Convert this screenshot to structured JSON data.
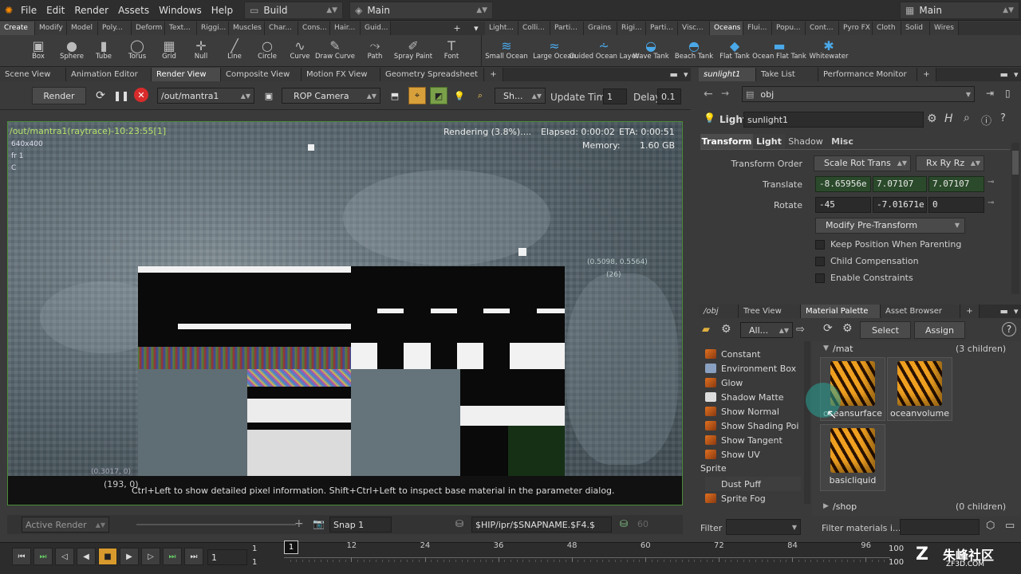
{
  "menubar": {
    "items": [
      "File",
      "Edit",
      "Render",
      "Assets",
      "Windows",
      "Help"
    ],
    "desktop_left": "Build",
    "desktop_mid": "Main",
    "desktop_right": "Main"
  },
  "shelf_tabs_left": [
    "Create",
    "Modify",
    "Model",
    "Poly...",
    "Deform",
    "Text...",
    "Riggi...",
    "Muscles",
    "Char...",
    "Cons...",
    "Hair...",
    "Guid..."
  ],
  "shelf_tabs_right": [
    "Light...",
    "Colli...",
    "Parti...",
    "Grains",
    "Rigi...",
    "Parti...",
    "Visc...",
    "Oceans",
    "Flui...",
    "Popu...",
    "Cont...",
    "Pyro FX",
    "Cloth",
    "Solid",
    "Wires"
  ],
  "tools_left": [
    {
      "label": "Box",
      "icon": "box-icon"
    },
    {
      "label": "Sphere",
      "icon": "sphere-icon"
    },
    {
      "label": "Tube",
      "icon": "tube-icon"
    },
    {
      "label": "Torus",
      "icon": "torus-icon"
    },
    {
      "label": "Grid",
      "icon": "grid-icon"
    },
    {
      "label": "Null",
      "icon": "null-icon"
    },
    {
      "label": "Line",
      "icon": "line-icon"
    },
    {
      "label": "Circle",
      "icon": "circle-icon"
    },
    {
      "label": "Curve",
      "icon": "curve-icon"
    },
    {
      "label": "Draw Curve",
      "icon": "draw-curve-icon"
    },
    {
      "label": "Path",
      "icon": "path-icon"
    },
    {
      "label": "Spray Paint",
      "icon": "spray-paint-icon"
    },
    {
      "label": "Font",
      "icon": "font-icon"
    }
  ],
  "tools_right": [
    {
      "label": "Small Ocean",
      "icon": "small-ocean-icon"
    },
    {
      "label": "Large Ocean",
      "icon": "large-ocean-icon"
    },
    {
      "label": "Guided Ocean Layer",
      "icon": "guided-ocean-icon"
    },
    {
      "label": "Wave Tank",
      "icon": "wave-tank-icon"
    },
    {
      "label": "Beach Tank",
      "icon": "beach-tank-icon"
    },
    {
      "label": "Flat Tank",
      "icon": "flat-tank-icon"
    },
    {
      "label": "Ocean Flat Tank",
      "icon": "ocean-flat-tank-icon"
    },
    {
      "label": "Whitewater",
      "icon": "whitewater-icon"
    }
  ],
  "pane_tabs_left": [
    "Scene View",
    "Animation Editor",
    "Render View",
    "Composite View",
    "Motion FX View",
    "Geometry Spreadsheet"
  ],
  "pane_tabs_right": [
    "sunlight1",
    "Take List",
    "Performance Monitor"
  ],
  "render_toolbar": {
    "render_label": "Render",
    "output_path": "/out/mantra1",
    "camera": "ROP Camera",
    "show_label": "Sh...",
    "update_time_label": "Update Time",
    "update_time_value": "1",
    "delay_label": "Delay",
    "delay_value": "0.1"
  },
  "viewport": {
    "title": "/out/mantra1(raytrace)-10:23:55[1]",
    "resolution": "640x400",
    "frame": "fr 1",
    "channel": "C",
    "rendering_status": "Rendering (3.8%)....",
    "elapsed": "Elapsed: 0:00:02",
    "eta": "ETA: 0:00:51",
    "memory_label": "Memory:",
    "memory_value": "1.60 GB",
    "coord_top": "(0.5098, 0.5564)",
    "coord_top2": "(26)",
    "coord_bottom": "(0.3017, 0)",
    "pixel_bottom": "(193, 0)",
    "hint": "Ctrl+Left to show detailed pixel information. Shift+Ctrl+Left to inspect base material in the parameter dialog."
  },
  "viewport_footer": {
    "active_render": "Active Render",
    "snap": "Snap 1",
    "snapname": "$HIP/ipr/$SNAPNAME.$F4.$",
    "num": "60"
  },
  "params": {
    "path": "obj",
    "node_type": "Light",
    "node_name": "sunlight1",
    "tabs": [
      "Transform",
      "Light",
      "Shadow",
      "Misc"
    ],
    "transform_order_label": "Transform Order",
    "transform_order": "Scale Rot Trans",
    "rot_order": "Rx Ry Rz",
    "translate_label": "Translate",
    "translate": [
      "-8.65956e",
      "7.07107",
      "7.07107"
    ],
    "rotate_label": "Rotate",
    "rotate": [
      "-45",
      "-7.01671e",
      "0"
    ],
    "modify_pre": "Modify Pre-Transform",
    "checks": [
      "Keep Position When Parenting",
      "Child Compensation",
      "Enable Constraints"
    ]
  },
  "mat_tabs": [
    "/obj",
    "Tree View",
    "Material Palette",
    "Asset Browser"
  ],
  "mat_toolbar": {
    "filter": "All...",
    "select": "Select",
    "assign": "Assign"
  },
  "mat_list": [
    "Constant",
    "Environment Box",
    "Glow",
    "Shadow Matte",
    "Show Normal",
    "Show Shading Poi",
    "Show Tangent",
    "Show UV"
  ],
  "mat_list_group2": "Sprite",
  "mat_list2": [
    "Dust Puff",
    "Sprite Fog"
  ],
  "mat_gallery": {
    "mat_path": "/mat",
    "mat_count": "(3 children)",
    "items": [
      "oceansurface",
      "oceanvolume",
      "basicliquid"
    ],
    "shop_path": "/shop",
    "shop_count": "(0 children)",
    "filter_label": "Filter",
    "filter_placeholder": "Filter materials i..."
  },
  "timeline": {
    "frame": "1",
    "start": "1",
    "start2": "1",
    "current": "1",
    "ticks": [
      "12",
      "24",
      "36",
      "48",
      "60",
      "72",
      "84",
      "96"
    ],
    "end": "100",
    "end2": "100"
  },
  "watermark": {
    "brand": "朱峰社区",
    "url": "ZF3D.COM"
  }
}
